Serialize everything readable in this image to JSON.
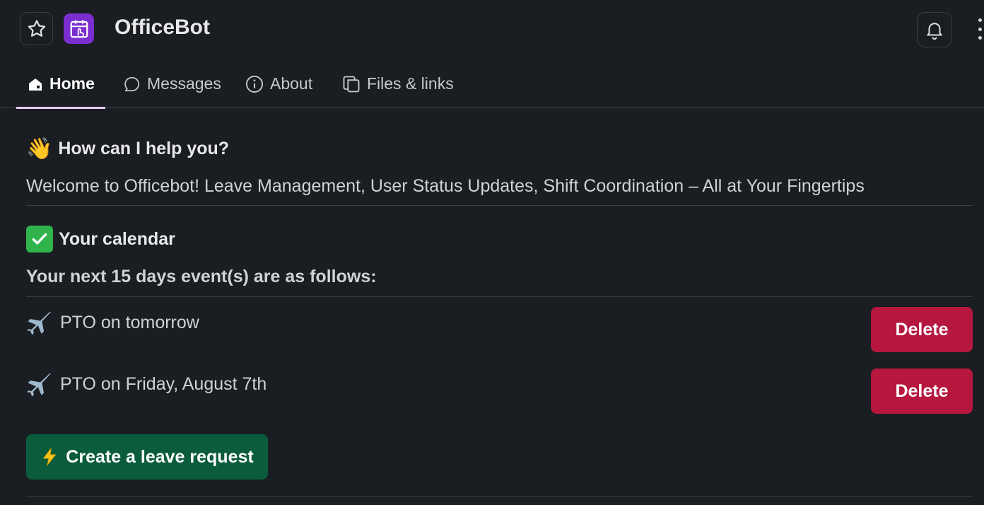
{
  "app": {
    "title": "OfficeBot"
  },
  "header": {
    "star_icon": "star-icon",
    "app_icon": "calendar-touch-icon",
    "bell_icon": "bell-icon",
    "more_icon": "more-vertical-icon"
  },
  "tabs": [
    {
      "label": "Home",
      "icon": "home-icon",
      "active": true
    },
    {
      "label": "Messages",
      "icon": "message-bubble-icon",
      "active": false
    },
    {
      "label": "About",
      "icon": "info-icon",
      "active": false
    },
    {
      "label": "Files & links",
      "icon": "files-icon",
      "active": false
    }
  ],
  "home": {
    "help_heading": "How can I help you?",
    "welcome_text": "Welcome to Officebot! Leave Management, User Status Updates, Shift Coordination – All at Your Fingertips",
    "calendar_heading": "Your calendar",
    "calendar_subheading": "Your next 15 days event(s) are as follows:",
    "events": [
      {
        "label": "PTO on tomorrow",
        "delete_label": "Delete"
      },
      {
        "label": "PTO on Friday, August 7th",
        "delete_label": "Delete"
      }
    ],
    "create_button": "Create a leave request"
  },
  "colors": {
    "background": "#1a1d21",
    "delete": "#b5173f",
    "create": "#0a5c3c",
    "app_icon": "#7b2ecf",
    "active_tab_underline": "#e6c8f3"
  }
}
